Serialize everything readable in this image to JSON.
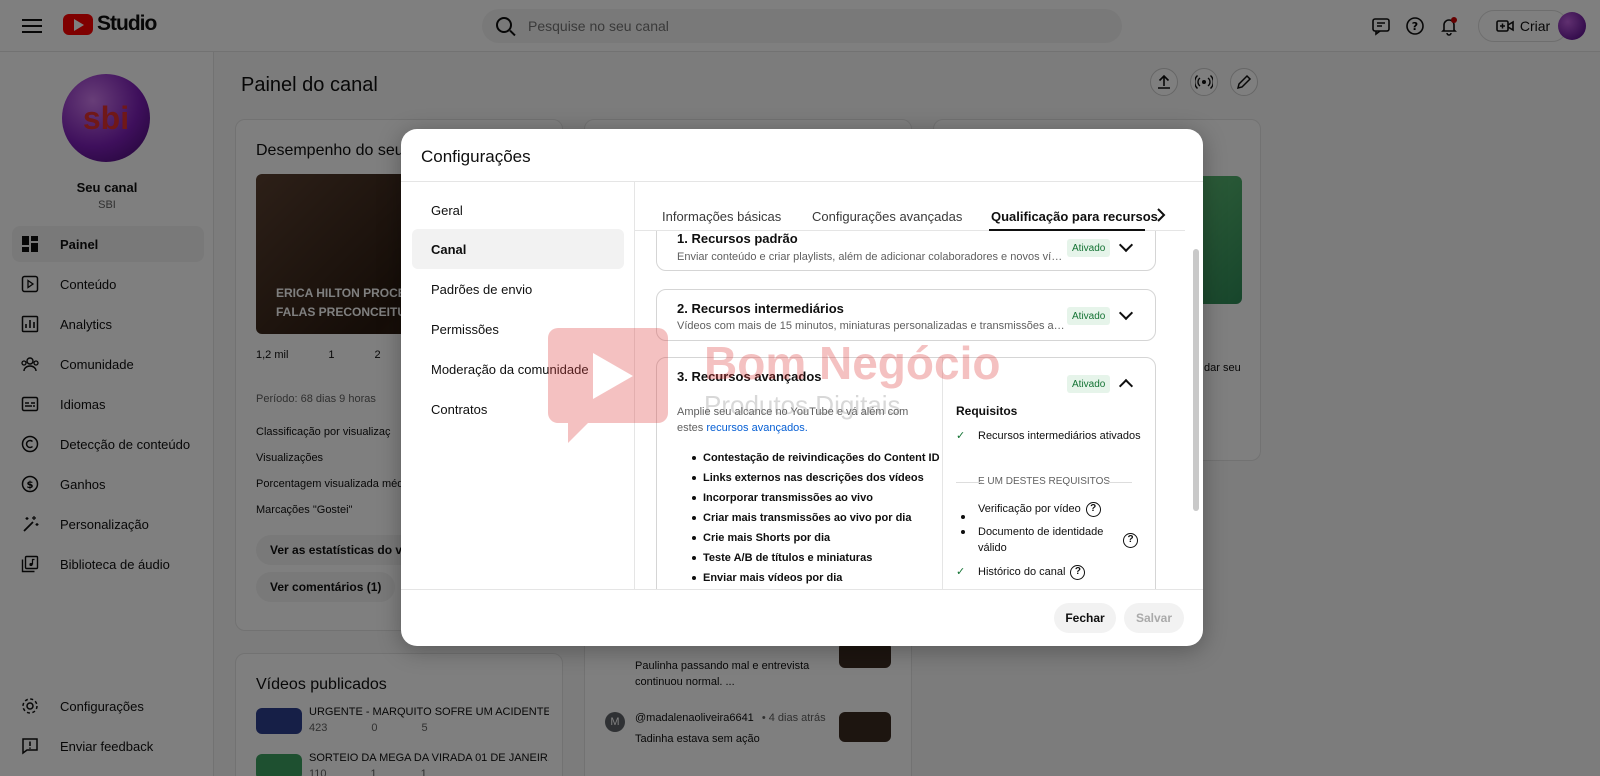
{
  "topbar": {
    "logo_text": "Studio",
    "search_placeholder": "Pesquise no seu canal",
    "create_label": "Criar"
  },
  "sidebar": {
    "channel_name": "Seu canal",
    "channel_handle": "SBI",
    "avatar_text": "sbi",
    "items": [
      {
        "label": "Painel",
        "icon": "dashboard-icon"
      },
      {
        "label": "Conteúdo",
        "icon": "content-icon"
      },
      {
        "label": "Analytics",
        "icon": "analytics-icon"
      },
      {
        "label": "Comunidade",
        "icon": "community-icon"
      },
      {
        "label": "Idiomas",
        "icon": "subtitles-icon"
      },
      {
        "label": "Detecção de conteúdo",
        "icon": "copyright-icon"
      },
      {
        "label": "Ganhos",
        "icon": "dollar-icon"
      },
      {
        "label": "Personalização",
        "icon": "magic-wand-icon"
      },
      {
        "label": "Biblioteca de áudio",
        "icon": "audio-library-icon"
      }
    ],
    "bottom_items": [
      {
        "label": "Configurações",
        "icon": "gear-icon"
      },
      {
        "label": "Enviar feedback",
        "icon": "feedback-icon"
      }
    ]
  },
  "main": {
    "page_title": "Painel do canal",
    "performance_title": "Desempenho do seu ú",
    "video_overlay_title": "ERICA HILTON PROCES FALAS PRECONCEITUO",
    "stats": {
      "views": "1,2 mil",
      "comments": "1",
      "likes": "2"
    },
    "period": "Período: 68 dias 9 horas",
    "rows": [
      "Classificação por visualizaç",
      "Visualizações",
      "Porcentagem visualizada méd",
      "Marcações \"Gostei\""
    ],
    "stats_button": "Ver as estatísticas do víd",
    "comments_button": "Ver comentários (1)",
    "published_title": "Vídeos publicados",
    "videos": [
      {
        "title": "URGENTE - MARQUITO SOFRE UM ACIDENTE ...",
        "views": "423",
        "comments": "0",
        "likes": "5"
      },
      {
        "title": "SORTEIO DA MEGA DA VIRADA 01 DE JANEIR...",
        "views": "110",
        "comments": "1",
        "likes": "1"
      }
    ],
    "comments": [
      {
        "text": "Paulinha passando mal e entrevista continuou normal. ..."
      },
      {
        "author": "@madalenaoliveira6641",
        "time": "• 4 dias atrás",
        "text": "Tadinha estava sem ação",
        "initial": "M"
      }
    ],
    "side_text": "dar seu"
  },
  "dialog": {
    "title": "Configurações",
    "nav": [
      "Geral",
      "Canal",
      "Padrões de envio",
      "Permissões",
      "Moderação da comunidade",
      "Contratos"
    ],
    "tabs": [
      "Informações básicas",
      "Configurações avançadas",
      "Qualificação para recursos"
    ],
    "sections": [
      {
        "title": "1. Recursos padrão",
        "desc": "Enviar conteúdo e criar playlists, além de adicionar colaboradores e novos víde...",
        "badge": "Ativado"
      },
      {
        "title": "2. Recursos intermediários",
        "desc": "Vídeos com mais de 15 minutos, miniaturas personalizadas e transmissões ao ...",
        "badge": "Ativado"
      },
      {
        "title": "3. Recursos avançados",
        "badge": "Ativado"
      }
    ],
    "advanced": {
      "intro": "Amplie seu alcance no YouTube e vá além com estes ",
      "intro_link": "recursos avançados.",
      "features": [
        "Contestação de reivindicações do Content ID",
        "Links externos nas descrições dos vídeos",
        "Incorporar transmissões ao vivo",
        "Criar mais transmissões ao vivo por dia",
        "Crie mais Shorts por dia",
        "Teste A/B de títulos e miniaturas",
        "Enviar mais vídeos por dia"
      ],
      "requirements_title": "Requisitos",
      "req_met": "Recursos intermediários ativados",
      "separator": "E UM DESTES REQUISITOS",
      "options": [
        {
          "label": "Verificação por vídeo",
          "checked": false
        },
        {
          "label": "Documento de identidade válido",
          "checked": false
        },
        {
          "label": "Histórico do canal",
          "checked": true
        }
      ]
    },
    "close_label": "Fechar",
    "save_label": "Salvar"
  },
  "watermark": {
    "line1": "Bom Negócio",
    "line2": "Produtos Digitais"
  }
}
